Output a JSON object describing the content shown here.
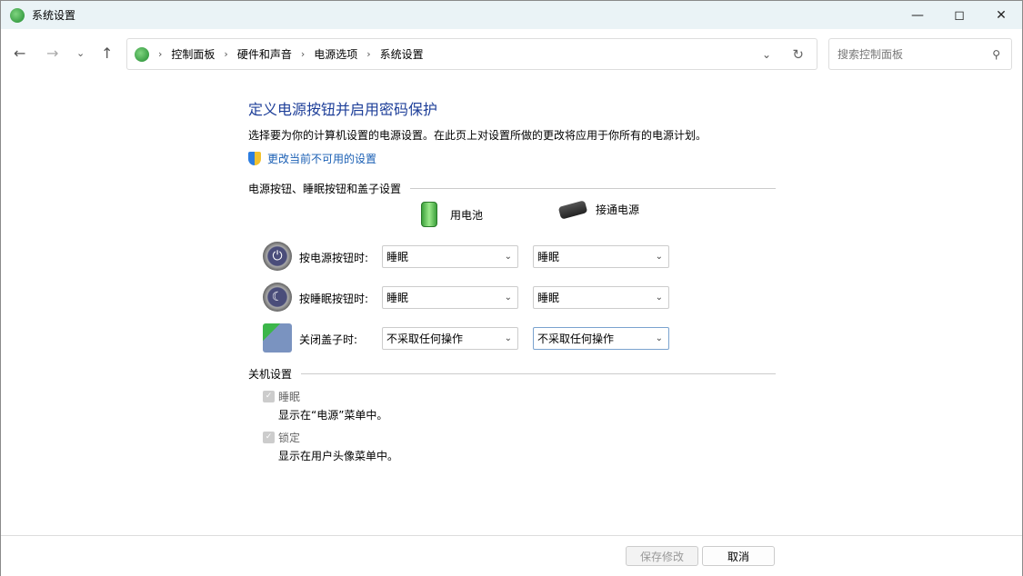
{
  "window": {
    "title": "系统设置"
  },
  "nav": {
    "breadcrumbs": [
      "控制面板",
      "硬件和声音",
      "电源选项",
      "系统设置"
    ],
    "search_placeholder": "搜索控制面板"
  },
  "main": {
    "heading": "定义电源按钮并启用密码保护",
    "description": "选择要为你的计算机设置的电源设置。在此页上对设置所做的更改将应用于你所有的电源计划。",
    "change_link": "更改当前不可用的设置",
    "group1": "电源按钮、睡眠按钮和盖子设置",
    "col_battery": "用电池",
    "col_plugged": "接通电源",
    "rows": [
      {
        "label": "按电源按钮时:",
        "battery": "睡眠",
        "plugged": "睡眠",
        "icon": "power-button-icon"
      },
      {
        "label": "按睡眠按钮时:",
        "battery": "睡眠",
        "plugged": "睡眠",
        "icon": "sleep-button-icon"
      },
      {
        "label": "关闭盖子时:",
        "battery": "不采取任何操作",
        "plugged": "不采取任何操作",
        "icon": "laptop-lid-icon"
      }
    ],
    "group2": "关机设置",
    "checks": [
      {
        "label": "睡眠",
        "sub": "显示在“电源”菜单中。",
        "checked": true,
        "disabled": true
      },
      {
        "label": "锁定",
        "sub": "显示在用户头像菜单中。",
        "checked": true,
        "disabled": true
      }
    ]
  },
  "footer": {
    "save": "保存修改",
    "cancel": "取消"
  }
}
